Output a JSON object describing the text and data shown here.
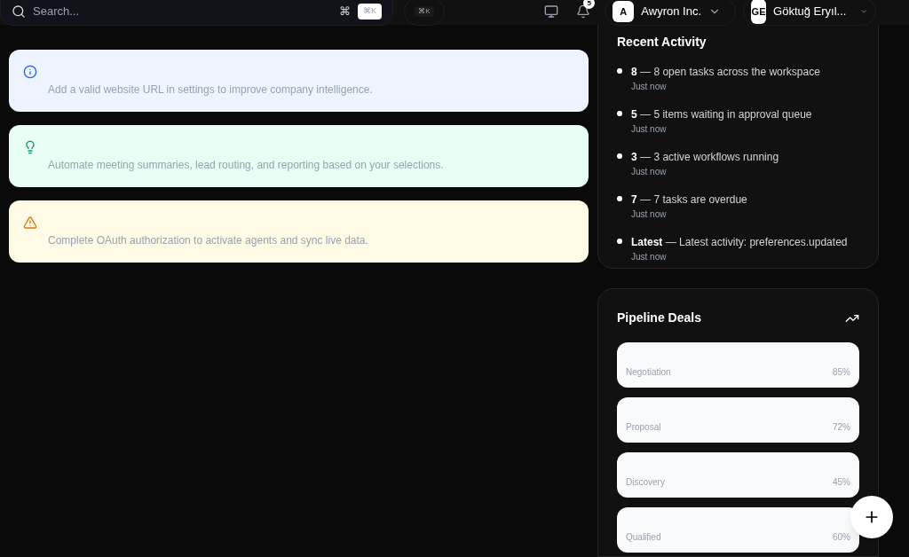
{
  "topbar": {
    "search": {
      "placeholder": "Search...",
      "shortcut_symbol": "⌘",
      "shortcut_key": "⌘K"
    },
    "command_button": "⌘K",
    "notifications": {
      "count": "5"
    },
    "workspace": {
      "initial": "A",
      "name": "Awyron Inc."
    },
    "user": {
      "initials": "GE",
      "name": "Göktuğ Eryıl..."
    }
  },
  "alerts": [
    {
      "kind": "info",
      "text": "Add a valid website URL in settings to improve company intelligence."
    },
    {
      "kind": "tip",
      "text": "Automate meeting summaries, lead routing, and reporting based on your selections."
    },
    {
      "kind": "warning",
      "text": "Complete OAuth authorization to activate agents and sync live data."
    }
  ],
  "recent_activity": {
    "title": "Recent Activity",
    "items": [
      {
        "label": "8",
        "separator": "—",
        "text": "8 open tasks across the workspace",
        "time": "Just now"
      },
      {
        "label": "5",
        "separator": "—",
        "text": "5 items waiting in approval queue",
        "time": "Just now"
      },
      {
        "label": "3",
        "separator": "—",
        "text": "3 active workflows running",
        "time": "Just now"
      },
      {
        "label": "7",
        "separator": "—",
        "text": "7 tasks are overdue",
        "time": "Just now"
      },
      {
        "label": "Latest",
        "separator": "—",
        "text": "Latest activity: preferences.updated",
        "time": "Just now"
      }
    ]
  },
  "pipeline": {
    "title": "Pipeline Deals",
    "stages": [
      {
        "name": "Negotiation",
        "percent": "85%"
      },
      {
        "name": "Proposal",
        "percent": "72%"
      },
      {
        "name": "Discovery",
        "percent": "45%"
      },
      {
        "name": "Qualified",
        "percent": "60%"
      }
    ]
  }
}
